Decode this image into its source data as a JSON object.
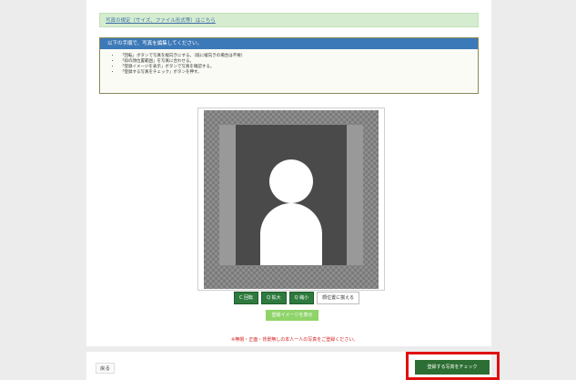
{
  "top_bar": {
    "link_text": "写真の規定（サイズ、ファイル形式等）はこちら"
  },
  "instructions": {
    "header": "以下の手順で、写真を編集してください。",
    "items": [
      "「回転」ボタンで写真を縦向きにする。（既に縦向きの場合は不要）",
      "「枠の顔位置範囲」を写真に合わせる。",
      "「登録イメージを表示」ボタンで写真を確認する。",
      "「登録する写真をチェック」ボタンを押す。"
    ]
  },
  "controls": {
    "rotate": "C 回転",
    "zoom_in": "Q 拡大",
    "zoom_out": "Q 縮小",
    "fit": "顔位置に揃える"
  },
  "preview_button": "登録イメージを表示",
  "notice": "※無帽・正面・背景無しの本人一人の写真をご登録ください。",
  "footer": {
    "back": "戻る",
    "check_button": "登録する写真をチェック"
  },
  "colors": {
    "accent_green": "#2c6e33",
    "header_blue": "#3c79b8",
    "highlight_red": "#e01010"
  }
}
